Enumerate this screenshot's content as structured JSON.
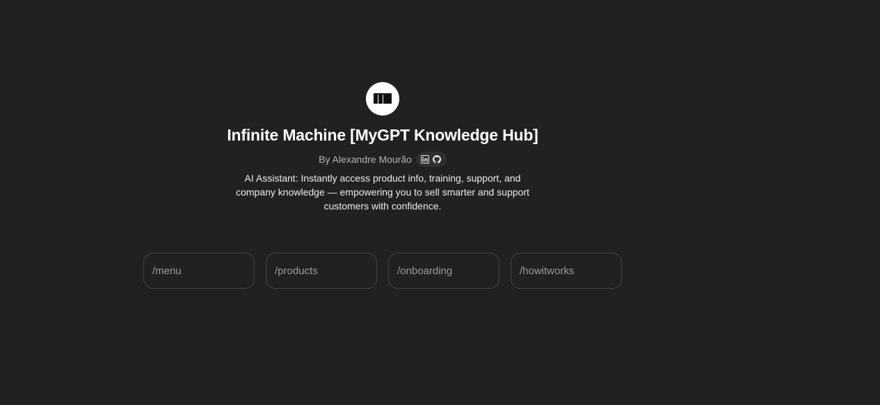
{
  "gpt": {
    "title": "Infinite Machine [MyGPT Knowledge Hub]",
    "byline": "By Alexandre Mourão",
    "description": "AI Assistant: Instantly access product info, training, support, and company knowledge — empowering you to sell smarter and support customers with confidence.",
    "avatar_icon": "book-columns-icon",
    "social_icons": [
      "linkedin-icon",
      "github-icon"
    ]
  },
  "starters": [
    {
      "label": "/menu"
    },
    {
      "label": "/products"
    },
    {
      "label": "/onboarding"
    },
    {
      "label": "/howitworks"
    }
  ],
  "colors": {
    "background": "#212121",
    "text": "#ffffff",
    "muted": "#b4b4b4",
    "border": "#424242"
  }
}
